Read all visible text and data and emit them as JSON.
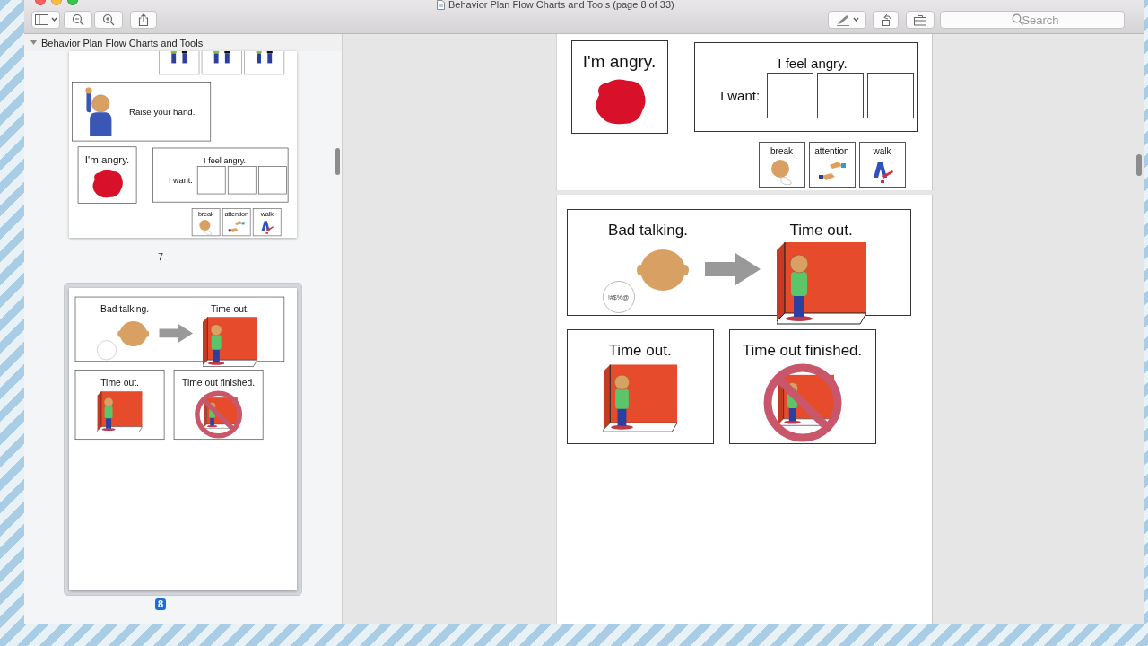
{
  "window": {
    "title": "Behavior Plan Flow Charts and Tools (page 8 of 33)"
  },
  "toolbar": {
    "search": {
      "placeholder": "Search"
    }
  },
  "sidebar": {
    "document_title": "Behavior Plan Flow Charts and Tools",
    "expanded": true,
    "thumbnails": [
      {
        "page_label": "7",
        "selected": false,
        "groups": [
          {
            "cards": [
              {
                "kind": "friend"
              },
              {
                "kind": "friend"
              },
              {
                "kind": "friend"
              }
            ]
          },
          {
            "cards": [
              {
                "kind": "raise",
                "label": "Raise your hand."
              }
            ]
          },
          {
            "cards": [
              {
                "kind": "feeling",
                "label": "I'm angry."
              },
              {
                "kind": "want",
                "title": "I feel angry.",
                "prompt": "I want:"
              }
            ]
          },
          {
            "cards": [
              {
                "kind": "choice",
                "label": "break"
              },
              {
                "kind": "choice",
                "label": "attention"
              },
              {
                "kind": "choice",
                "label": "walk"
              }
            ]
          }
        ]
      },
      {
        "page_label": "8",
        "selected": true,
        "groups": [
          {
            "cards": [
              {
                "kind": "consequence",
                "label": "Bad talking.",
                "result": "Time out."
              }
            ]
          },
          {
            "cards": [
              {
                "kind": "timeout",
                "label": "Time out."
              },
              {
                "kind": "finished",
                "label": "Time out finished."
              }
            ]
          }
        ]
      }
    ]
  },
  "document": {
    "pages": [
      {
        "groups": [
          {
            "cards": [
              {
                "kind": "feeling",
                "label": "I'm angry."
              },
              {
                "kind": "want",
                "title": "I feel angry.",
                "prompt": "I want:"
              }
            ]
          },
          {
            "cards": [
              {
                "kind": "choice",
                "label": "break"
              },
              {
                "kind": "choice",
                "label": "attention"
              },
              {
                "kind": "choice",
                "label": "walk"
              }
            ]
          }
        ]
      },
      {
        "groups": [
          {
            "cards": [
              {
                "kind": "consequence",
                "label": "Bad talking.",
                "result": "Time out.",
                "bubble": "!#$%@"
              }
            ]
          },
          {
            "cards": [
              {
                "kind": "timeout",
                "label": "Time out."
              },
              {
                "kind": "finished",
                "label": "Time out finished."
              }
            ]
          }
        ]
      }
    ]
  }
}
